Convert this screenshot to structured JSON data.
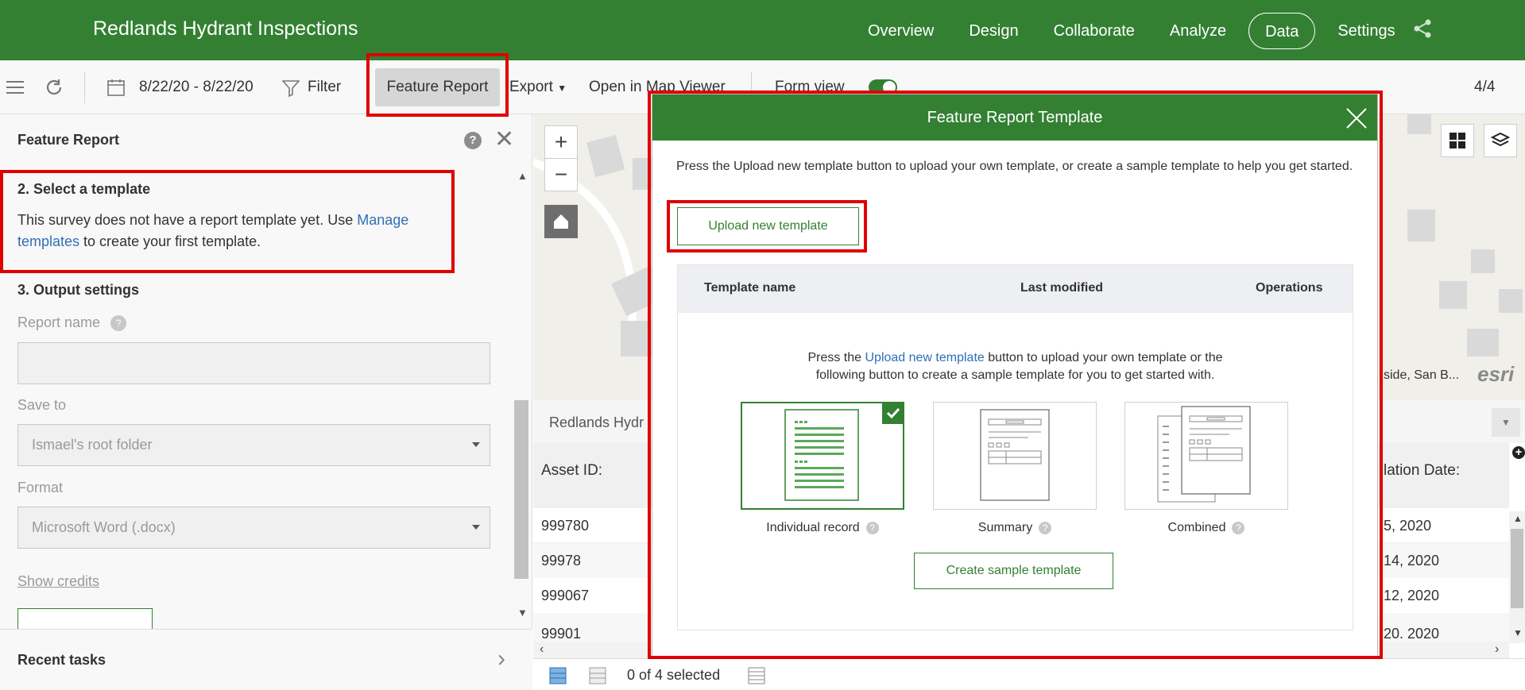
{
  "header": {
    "app_title": "Redlands Hydrant Inspections",
    "nav": [
      "Overview",
      "Design",
      "Collaborate",
      "Analyze",
      "Data",
      "Settings"
    ],
    "active_nav": "Data"
  },
  "toolbar": {
    "date_range": "8/22/20 - 8/22/20",
    "filter": "Filter",
    "feature_report": "Feature Report",
    "export": "Export",
    "open_map_viewer": "Open in Map Viewer",
    "form_view": "Form view",
    "record_count": "4/4"
  },
  "left_panel": {
    "title": "Feature Report",
    "section2_title": "2. Select a template",
    "section2_text_a": "This survey does not have a report template yet. Use ",
    "section2_link": "Manage templates",
    "section2_text_b": " to create your first template.",
    "section3_title": "3. Output settings",
    "report_name_label": "Report name",
    "report_name_value": "",
    "save_to_label": "Save to",
    "save_to_value": "Ismael's root folder",
    "format_label": "Format",
    "format_value": "Microsoft Word (.docx)",
    "show_credits": "Show credits",
    "recent_tasks": "Recent tasks"
  },
  "table": {
    "layer_title": "Redlands Hydr",
    "col_asset": "Asset ID:",
    "col_install": "lation Date:",
    "rows": [
      {
        "asset": "999780",
        "date": "5, 2020"
      },
      {
        "asset": "99978",
        "date": "14, 2020"
      },
      {
        "asset": "999067",
        "date": "12, 2020"
      },
      {
        "asset": "99901",
        "date": "20. 2020"
      }
    ],
    "selected_text": "0 of 4 selected"
  },
  "map": {
    "attribution": "side, San B...",
    "esri": "esri"
  },
  "modal": {
    "title": "Feature Report Template",
    "intro": "Press the Upload new template button to upload your own template, or create a sample template to help you get started.",
    "upload_button": "Upload new template",
    "col_name": "Template name",
    "col_modified": "Last modified",
    "col_operations": "Operations",
    "msg_a": "Press the ",
    "msg_link": "Upload new template",
    "msg_b": " button to upload your own template or the",
    "msg_line2": "following button to create a sample template for you to get started with.",
    "templates": [
      "Individual record",
      "Summary",
      "Combined"
    ],
    "create_button": "Create sample template"
  },
  "colors": {
    "brand_green": "#338033",
    "highlight_red": "#e00000",
    "link_blue": "#2f6fb5"
  }
}
